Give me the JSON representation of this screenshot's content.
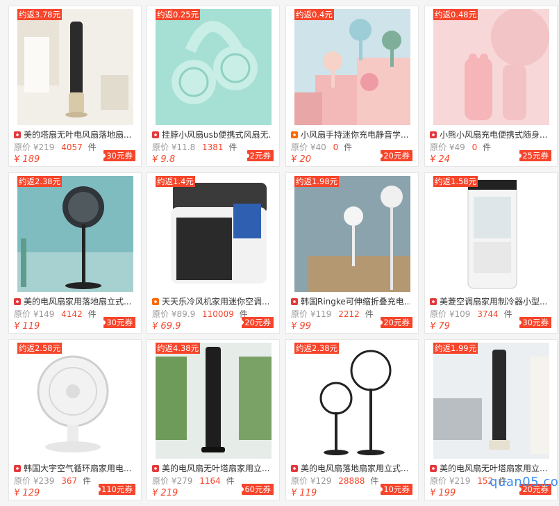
{
  "currency": "¥",
  "orig_label": "原价",
  "unit": "件",
  "watermark": "quan05.com",
  "products": [
    {
      "rebate": "约返3.78元",
      "title": "美的塔扇无叶电风扇落地扇...",
      "orig": "219",
      "sales": "4057",
      "price": "189",
      "coupon": "30元券",
      "src": "tb",
      "icon": "tower-fan-image"
    },
    {
      "rebate": "约返0.25元",
      "title": "挂脖小风扇usb便携式风扇无...",
      "orig": "11.8",
      "sales": "1381",
      "price": "9.8",
      "coupon": "2元券",
      "src": "tb",
      "icon": "neck-fan-image"
    },
    {
      "rebate": "约返0.4元",
      "title": "小风扇手持迷你充电静音学...",
      "orig": "40",
      "sales": "0",
      "price": "20",
      "coupon": "20元券",
      "src": "tm",
      "icon": "handheld-fans-image"
    },
    {
      "rebate": "约返0.48元",
      "title": "小熊小风扇充电便携式随身...",
      "orig": "49",
      "sales": "0",
      "price": "24",
      "coupon": "25元券",
      "src": "tb",
      "icon": "pink-handheld-fan-image"
    },
    {
      "rebate": "约返2.38元",
      "title": "美的电风扇家用落地扇立式...",
      "orig": "149",
      "sales": "4142",
      "price": "119",
      "coupon": "30元券",
      "src": "tb",
      "icon": "standing-fan-image"
    },
    {
      "rebate": "约返1.4元",
      "title": "天天乐冷风机家用迷你空调...",
      "orig": "89.9",
      "sales": "110009",
      "price": "69.9",
      "coupon": "20元券",
      "src": "tm",
      "icon": "mini-air-cooler-image"
    },
    {
      "rebate": "约返1.98元",
      "title": "韩国Ringke可伸缩折叠充电...",
      "orig": "119",
      "sales": "2212",
      "price": "99",
      "coupon": "20元券",
      "src": "tb",
      "icon": "folding-fan-image"
    },
    {
      "rebate": "约返1.58元",
      "title": "美菱空调扇家用制冷器小型...",
      "orig": "109",
      "sales": "3744",
      "price": "79",
      "coupon": "30元券",
      "src": "tb",
      "icon": "air-cooler-image"
    },
    {
      "rebate": "约返2.58元",
      "title": "韩国大宇空气循环扇家用电...",
      "orig": "239",
      "sales": "367",
      "price": "129",
      "coupon": "110元券",
      "src": "tb",
      "icon": "circulation-fan-image"
    },
    {
      "rebate": "约返4.38元",
      "title": "美的电风扇无叶塔扇家用立...",
      "orig": "279",
      "sales": "1164",
      "price": "219",
      "coupon": "60元券",
      "src": "tb",
      "icon": "black-tower-fan-image"
    },
    {
      "rebate": "约返2.38元",
      "title": "美的电风扇落地扇家用立式...",
      "orig": "129",
      "sales": "28888",
      "price": "119",
      "coupon": "10元券",
      "src": "tb",
      "icon": "two-standing-fans-image"
    },
    {
      "rebate": "约返1.99元",
      "title": "美的电风扇无叶塔扇家用立...",
      "orig": "219",
      "sales": "152",
      "price": "199",
      "coupon": "20元券",
      "src": "tb",
      "icon": "tower-fan-living-room-image"
    }
  ]
}
